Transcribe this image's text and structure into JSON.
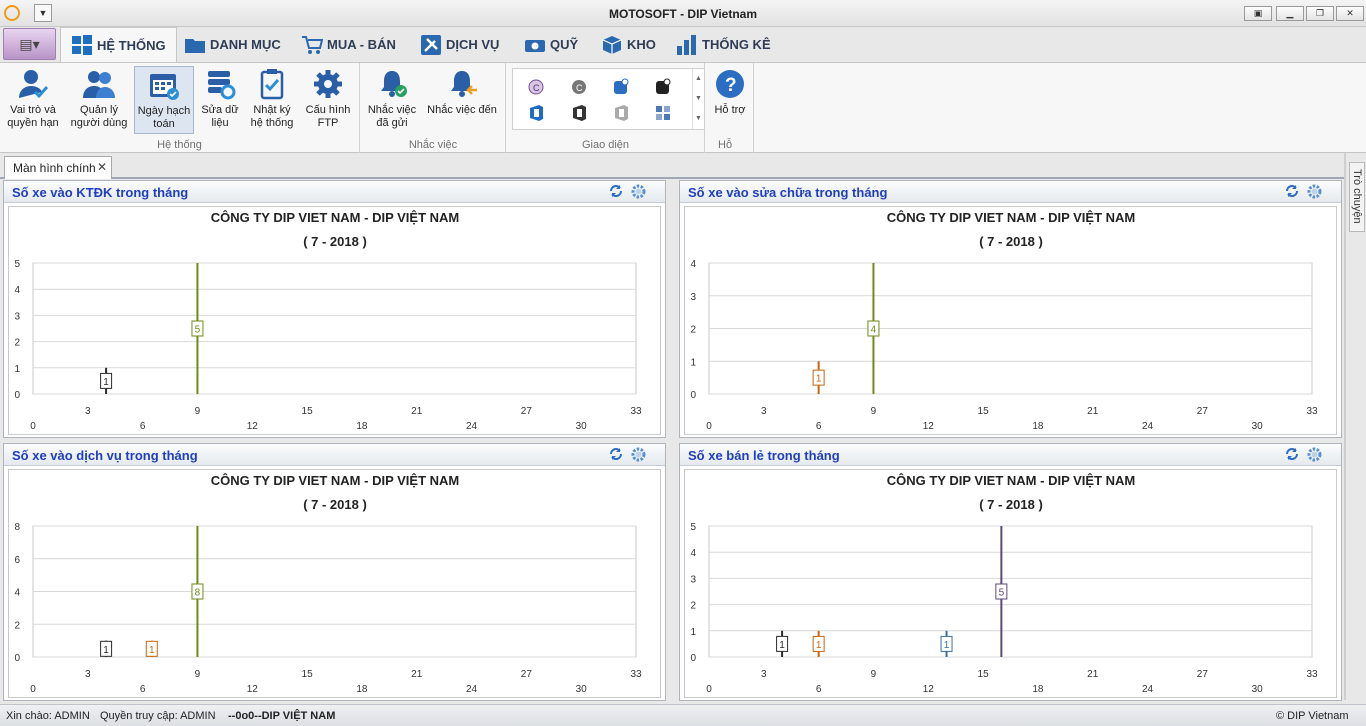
{
  "app": {
    "title": "MOTOSOFT - DIP Vietnam"
  },
  "ribbon_tabs": [
    {
      "label": "HỆ THỐNG",
      "icon": "windows-icon"
    },
    {
      "label": "DANH MỤC",
      "icon": "folder-icon"
    },
    {
      "label": "MUA - BÁN",
      "icon": "cart-icon"
    },
    {
      "label": "DỊCH VỤ",
      "icon": "tools-icon"
    },
    {
      "label": "QUỸ",
      "icon": "money-icon"
    },
    {
      "label": "KHO",
      "icon": "box-icon"
    },
    {
      "label": "THỐNG KÊ",
      "icon": "bar-chart-icon"
    }
  ],
  "ribbon": {
    "he_thong": {
      "label": "Hệ thống",
      "buttons": [
        {
          "line1": "Vai trò và",
          "line2": "quyền hạn",
          "icon": "user-check-icon"
        },
        {
          "line1": "Quản lý",
          "line2": "người dùng",
          "icon": "users-icon"
        },
        {
          "line1": "Ngày hạch",
          "line2": "toán",
          "icon": "calendar-icon"
        },
        {
          "line1": "Sửa dữ",
          "line2": "liệu",
          "icon": "database-gear-icon"
        },
        {
          "line1": "Nhật ký",
          "line2": "hệ thống",
          "icon": "clipboard-check-icon"
        },
        {
          "line1": "Cấu hình",
          "line2": "FTP",
          "icon": "gear-icon"
        }
      ]
    },
    "nhac_viec": {
      "label": "Nhắc việc",
      "buttons": [
        {
          "line1": "Nhắc việc",
          "line2": "đã gửi",
          "icon": "bell-sent-icon"
        },
        {
          "line1": "Nhắc việc đến",
          "line2": "",
          "icon": "bell-incoming-icon"
        }
      ]
    },
    "giao_dien": {
      "label": "Giao diện"
    },
    "ho_tro": {
      "label": "Hỗ",
      "button": "Hỗ trợ",
      "icon": "help-icon"
    }
  },
  "doc_tab": {
    "label": "Màn hình chính",
    "close": "✕"
  },
  "side_panel": {
    "label": "Trò chuyện"
  },
  "colors": {
    "title_blue": "#1f3fbf",
    "grid": "#d9d9d9",
    "black": "#2b2b2b",
    "orange": "#c8650f",
    "green": "#6e8a17",
    "blue": "#3a6ea5",
    "purple": "#5b4a7a"
  },
  "panels": [
    {
      "title": "Số xe vào KTĐK trong tháng",
      "chart_data": {
        "type": "bar",
        "title": "CÔNG TY DIP VIET NAM - DIP VIỆT NAM",
        "subtitle": "( 7 - 2018 )",
        "x_ticks_top": [
          "3",
          "9",
          "15",
          "21",
          "27",
          "33"
        ],
        "x_ticks_bottom": [
          "0",
          "6",
          "12",
          "18",
          "24",
          "30"
        ],
        "xlim": [
          0,
          33
        ],
        "y_ticks": [
          "0",
          "1",
          "2",
          "3",
          "4",
          "5"
        ],
        "ylim": [
          0,
          5
        ],
        "series": [
          {
            "x": 4,
            "value": 1,
            "label": "1",
            "color": "#2b2b2b"
          },
          {
            "x": 9,
            "value": 5,
            "label": "5",
            "color": "#6e8a17"
          }
        ]
      }
    },
    {
      "title": "Số xe vào sửa chữa trong tháng",
      "chart_data": {
        "type": "bar",
        "title": "CÔNG TY DIP VIET NAM - DIP VIỆT NAM",
        "subtitle": "( 7 - 2018 )",
        "x_ticks_top": [
          "3",
          "9",
          "15",
          "21",
          "27",
          "33"
        ],
        "x_ticks_bottom": [
          "0",
          "6",
          "12",
          "18",
          "24",
          "30"
        ],
        "xlim": [
          0,
          33
        ],
        "y_ticks": [
          "0",
          "1",
          "2",
          "3",
          "4"
        ],
        "ylim": [
          0,
          4
        ],
        "series": [
          {
            "x": 6,
            "value": 1,
            "label": "1",
            "color": "#c8650f"
          },
          {
            "x": 9,
            "value": 4,
            "label": "4",
            "color": "#6e8a17"
          }
        ]
      }
    },
    {
      "title": "Số xe vào dịch vụ trong tháng",
      "chart_data": {
        "type": "bar",
        "title": "CÔNG TY DIP VIET NAM - DIP VIỆT NAM",
        "subtitle": "( 7 - 2018 )",
        "x_ticks_top": [
          "3",
          "9",
          "15",
          "21",
          "27",
          "33"
        ],
        "x_ticks_bottom": [
          "0",
          "6",
          "12",
          "18",
          "24",
          "30"
        ],
        "xlim": [
          0,
          33
        ],
        "y_ticks": [
          "0",
          "2",
          "4",
          "6",
          "8"
        ],
        "ylim": [
          0,
          8
        ],
        "series": [
          {
            "x": 4,
            "value": 1,
            "label": "1",
            "color": "#2b2b2b"
          },
          {
            "x": 6.5,
            "value": 1,
            "label": "1",
            "color": "#c8650f"
          },
          {
            "x": 9,
            "value": 8,
            "label": "8",
            "color": "#6e8a17"
          }
        ]
      }
    },
    {
      "title": "Số xe bán lẻ trong tháng",
      "chart_data": {
        "type": "bar",
        "title": "CÔNG TY DIP VIET NAM - DIP VIỆT NAM",
        "subtitle": "( 7 - 2018 )",
        "x_ticks_top": [
          "3",
          "9",
          "15",
          "21",
          "27",
          "33"
        ],
        "x_ticks_bottom": [
          "0",
          "6",
          "12",
          "18",
          "24",
          "30"
        ],
        "xlim": [
          0,
          33
        ],
        "y_ticks": [
          "0",
          "1",
          "2",
          "3",
          "4",
          "5"
        ],
        "ylim": [
          0,
          5
        ],
        "series": [
          {
            "x": 4,
            "value": 1,
            "label": "1",
            "color": "#2b2b2b"
          },
          {
            "x": 6,
            "value": 1,
            "label": "1",
            "color": "#c8650f"
          },
          {
            "x": 13,
            "value": 1,
            "label": "1",
            "color": "#3a6ea5"
          },
          {
            "x": 16,
            "value": 5,
            "label": "5",
            "color": "#5b4a7a"
          }
        ]
      }
    }
  ],
  "status": {
    "greeting": "Xin chào: ADMIN",
    "access": "Quyền truy cập: ADMIN",
    "company": "--0o0--DIP VIỆT NAM",
    "copyright": "© DIP Vietnam"
  }
}
